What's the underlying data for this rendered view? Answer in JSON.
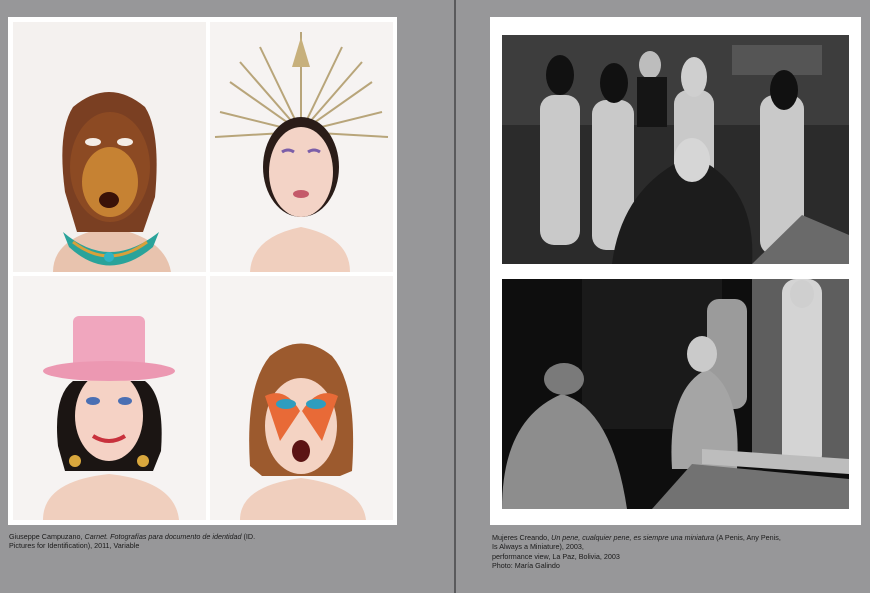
{
  "left_page": {
    "caption": {
      "artist": "Giuseppe Campuzano, ",
      "title": "Carnet. Fotografías para documento de identidad",
      "rest": " (ID. Pictures for Identification), 2011, Variable"
    },
    "images": [
      {
        "subject": "bronze-face-portrait"
      },
      {
        "subject": "halo-crown-portrait"
      },
      {
        "subject": "pink-hat-portrait"
      },
      {
        "subject": "glam-makeup-portrait"
      }
    ]
  },
  "right_page": {
    "caption": {
      "artist": "Mujeres Creando, ",
      "title": "Un pene, cualquier pene, es siempre una miniatura",
      "line1_rest": " (A Penis, Any Penis, Is Always a Miniature), 2003,",
      "line2": "performance view, La Paz, Bolivia, 2003",
      "line3": "Photo: María Galindo"
    },
    "images": [
      {
        "subject": "masked-performers-photo"
      },
      {
        "subject": "night-performance-photo"
      }
    ]
  },
  "colors": {
    "background": "#979799",
    "page": "#ffffff",
    "divider": "#5a5a5c"
  }
}
